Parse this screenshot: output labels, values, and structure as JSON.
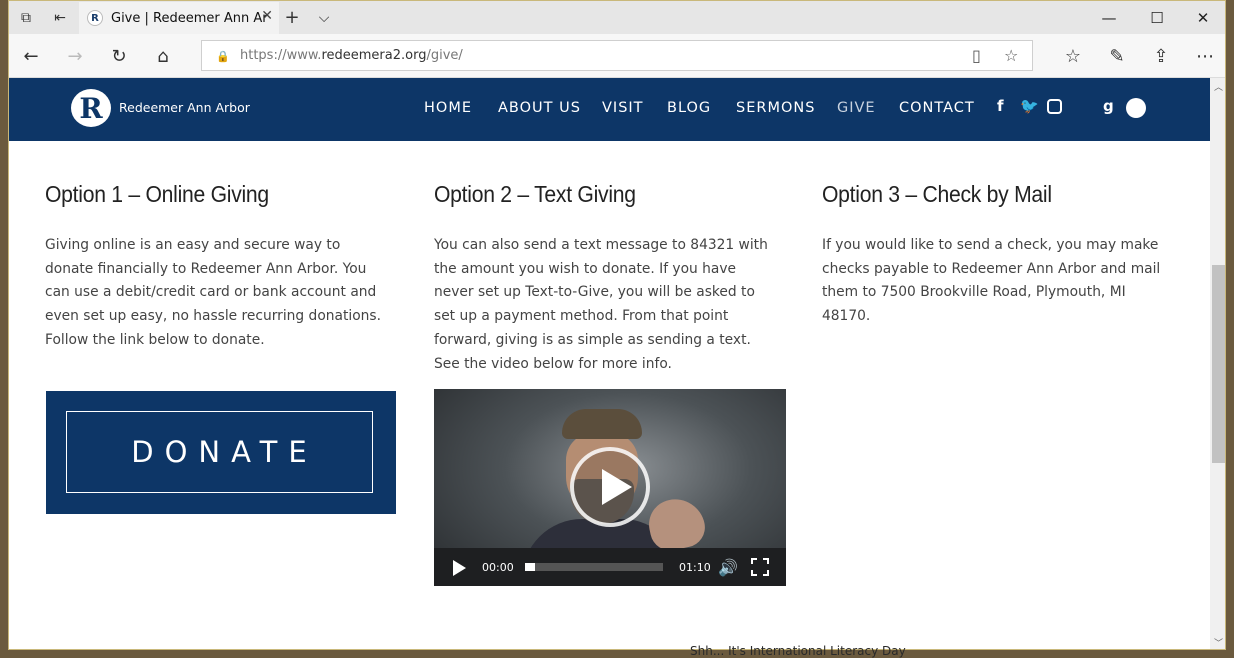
{
  "browser": {
    "tab_title": "Give | Redeemer Ann Ar",
    "url_prefix": "https://www.",
    "url_domain": "redeemera2.org",
    "url_path": "/give/"
  },
  "site": {
    "logo_letter": "R",
    "logo_text": "Redeemer Ann Arbor",
    "nav": {
      "home": "HOME",
      "about": "ABOUT US",
      "visit": "VISIT",
      "blog": "BLOG",
      "sermons": "SERMONS",
      "give": "GIVE",
      "contact": "CONTACT"
    },
    "social": {
      "facebook": "f",
      "google": "g"
    }
  },
  "options": {
    "online": {
      "title": "Option 1 – Online Giving",
      "body": "Giving online is an easy and secure way to donate financially to Redeemer Ann Arbor. You can use a debit/credit card or bank account and even set up easy, no hassle recurring donations. Follow the link below to donate.",
      "donate_label": "DONATE"
    },
    "text": {
      "title": "Option 2 – Text Giving",
      "body": "You can also send a text message to 84321 with the amount you wish to donate. If you have never set up Text-to-Give, you will be asked to set up a payment method. From that point forward, giving is as simple as sending a text. See the video below for more info.",
      "video_current": "00:00",
      "video_duration": "01:10",
      "video_progress": 0.0
    },
    "check": {
      "title": "Option 3 – Check by Mail",
      "body": "If you would like to send a check, you may make checks payable to Redeemer Ann Arbor and mail them to 7500 Brookville Road, Plymouth, MI 48170."
    }
  },
  "desktop_bg_text": "Shh... It's International Literacy Day",
  "colors": {
    "brand_navy": "#0d3667",
    "text_gray": "#444444"
  }
}
